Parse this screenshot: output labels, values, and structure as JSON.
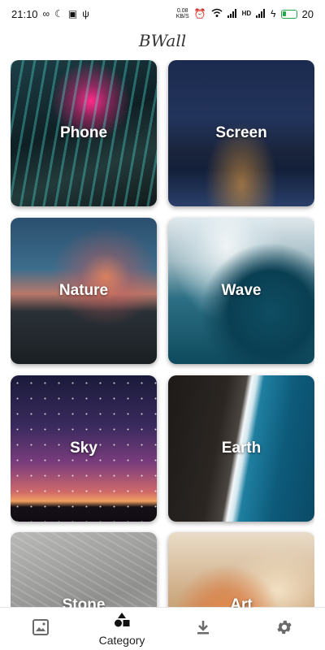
{
  "status_bar": {
    "time": "21:10",
    "network_speed_value": "0.08",
    "network_speed_unit": "KB/S",
    "battery_level": "20",
    "icons": [
      "infinity-icon",
      "moon-icon",
      "android-icon",
      "usb-icon",
      "alarm-icon",
      "wifi-icon",
      "signal-icon",
      "hd-icon",
      "signal-icon",
      "charging-icon",
      "battery-icon"
    ]
  },
  "app": {
    "title": "BWall"
  },
  "categories": [
    {
      "label": "Phone"
    },
    {
      "label": "Screen"
    },
    {
      "label": "Nature"
    },
    {
      "label": "Wave"
    },
    {
      "label": "Sky"
    },
    {
      "label": "Earth"
    },
    {
      "label": "Stone"
    },
    {
      "label": "Art"
    }
  ],
  "bottom_nav": {
    "items": [
      {
        "icon": "image-icon",
        "label": ""
      },
      {
        "icon": "category-icon",
        "label": "Category"
      },
      {
        "icon": "download-icon",
        "label": ""
      },
      {
        "icon": "gear-icon",
        "label": ""
      }
    ],
    "active_index": 1
  }
}
